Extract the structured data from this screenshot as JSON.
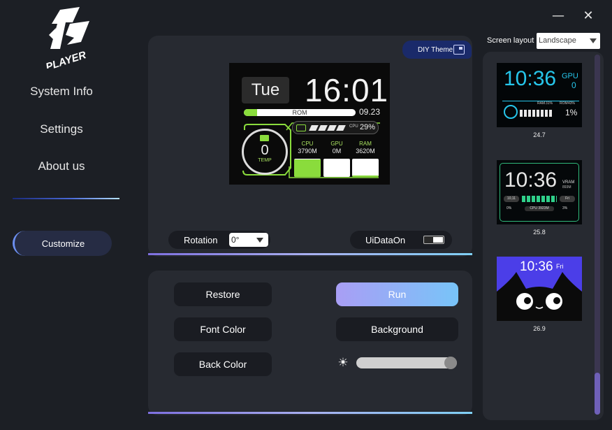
{
  "window": {
    "minimize_glyph": "—",
    "close_glyph": "✕"
  },
  "logo": {
    "text": "1st PLAYER"
  },
  "sidebar": {
    "items": [
      {
        "label": "System Info"
      },
      {
        "label": "Settings"
      },
      {
        "label": "About us"
      }
    ],
    "customize_label": "Customize"
  },
  "diy_theme": {
    "label": "DIY Theme"
  },
  "preview": {
    "day": "Tue",
    "time": "16:01",
    "rom_label": "ROM",
    "rom_fill": 0.12,
    "rom_value": "09.23",
    "cpu_label": "CPU",
    "cpu_value": "29%",
    "temp_value": "0",
    "temp_label": "TEMP",
    "stats": [
      {
        "label": "CPU",
        "value": "3790M",
        "fill": 0.95
      },
      {
        "label": "GPU",
        "value": "0M",
        "fill": 0.0
      },
      {
        "label": "RAM",
        "value": "3620M",
        "fill": 0.08
      }
    ]
  },
  "controls": {
    "rotation_label": "Rotation",
    "rotation_value": "0°",
    "uidata_label": "UiDataOn"
  },
  "actions": {
    "restore": "Restore",
    "run": "Run",
    "font_color": "Font Color",
    "background": "Background",
    "back_color": "Back Color",
    "brightness_icon": "☀",
    "brightness_level": 1.0
  },
  "screen_layout": {
    "label": "Screen layout",
    "value": "Landscape"
  },
  "themes": [
    {
      "caption": "24.7",
      "time": "10:36",
      "gpu_label": "GPU",
      "gpu_value": "0",
      "ram_label": "RAM",
      "ram_value": "31%",
      "rom_label": "ROM",
      "rom_value": "43%",
      "cpu_value": "1%"
    },
    {
      "caption": "25.8",
      "time": "10:36",
      "vram_label": "VRAM",
      "vram_value": "893M",
      "date": "10,11",
      "day": "Fri",
      "cpu_text": "CPU 3923M",
      "left_stat": "0%",
      "right_stat": "3%"
    },
    {
      "caption": "26.9",
      "time": "10:36",
      "day": "Fri"
    }
  ],
  "colors": {
    "accent_green": "#8adc3c",
    "accent_cyan": "#26c5ea",
    "run_gradient_start": "#a99ef5",
    "run_gradient_end": "#78c4f8",
    "panel_bg": "#272a31",
    "app_bg": "#1c1f25"
  }
}
